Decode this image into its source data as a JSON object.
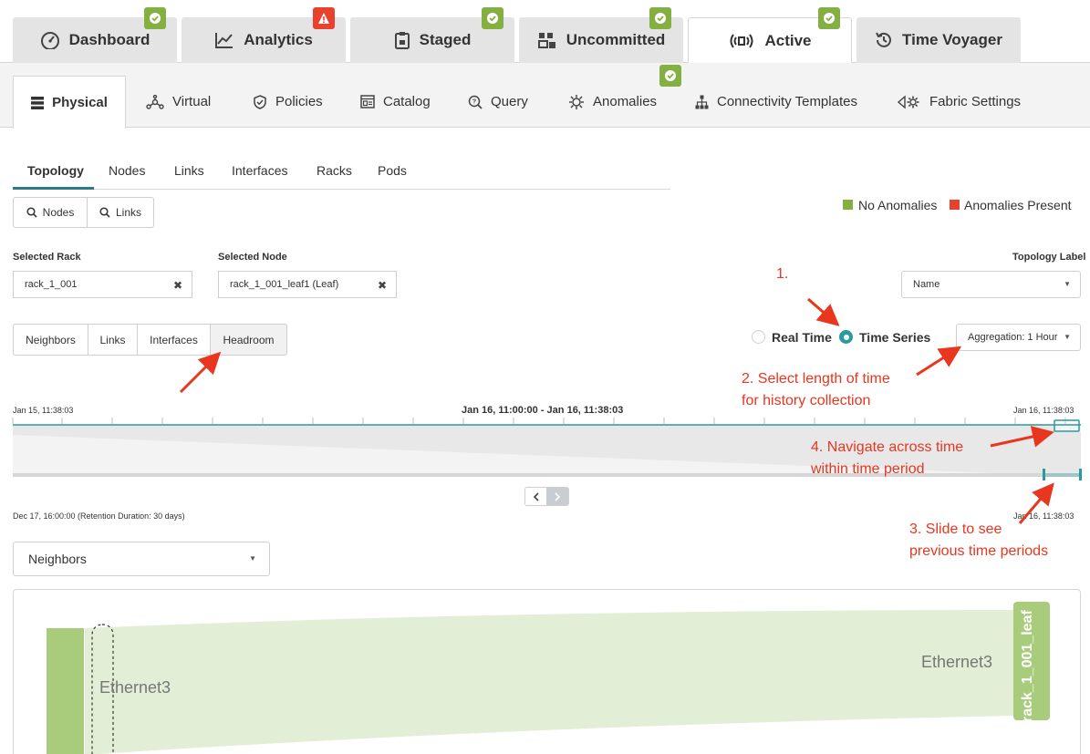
{
  "top_tabs": [
    {
      "label": "Dashboard",
      "icon": "gauge-icon",
      "status": "ok"
    },
    {
      "label": "Analytics",
      "icon": "chart-line-icon",
      "status": "warning"
    },
    {
      "label": "Staged",
      "icon": "clipboard-icon",
      "status": "ok"
    },
    {
      "label": "Uncommitted",
      "icon": "diff-icon",
      "status": "ok"
    },
    {
      "label": "Active",
      "icon": "broadcast-icon",
      "status": "ok",
      "active": true
    },
    {
      "label": "Time Voyager",
      "icon": "history-icon"
    }
  ],
  "sub_tabs": [
    {
      "label": "Physical",
      "icon": "server-icon",
      "active": true
    },
    {
      "label": "Virtual",
      "icon": "network-nodes-icon"
    },
    {
      "label": "Policies",
      "icon": "shield-icon"
    },
    {
      "label": "Catalog",
      "icon": "catalog-icon"
    },
    {
      "label": "Query",
      "icon": "search-query-icon"
    },
    {
      "label": "Anomalies",
      "icon": "anomaly-icon",
      "status": "ok"
    },
    {
      "label": "Connectivity Templates",
      "icon": "hierarchy-icon"
    },
    {
      "label": "Fabric Settings",
      "icon": "fabric-settings-icon"
    }
  ],
  "view_tabs": [
    "Topology",
    "Nodes",
    "Links",
    "Interfaces",
    "Racks",
    "Pods"
  ],
  "search": {
    "nodes": "Nodes",
    "links": "Links"
  },
  "legend": {
    "ok": "No Anomalies",
    "bad": "Anomalies Present",
    "ok_color": "#84b042",
    "bad_color": "#e8412e"
  },
  "selected_rack": {
    "label": "Selected Rack",
    "value": "rack_1_001"
  },
  "selected_node": {
    "label": "Selected Node",
    "value": "rack_1_001_leaf1 (Leaf)"
  },
  "topology_label": {
    "label": "Topology Label",
    "value": "Name"
  },
  "mode_tabs": [
    "Neighbors",
    "Links",
    "Interfaces",
    "Headroom"
  ],
  "mode_active": "Headroom",
  "radio": {
    "real_time": "Real Time",
    "time_series": "Time Series",
    "selected": "Time Series"
  },
  "aggregation": "Aggregation: 1 Hour",
  "timeline": {
    "start": "Jan 15, 11:38:03",
    "range": "Jan 16, 11:00:00 - Jan 16, 11:38:03",
    "end": "Jan 16, 11:38:03",
    "retention": "Dec 17, 16:00:00 (Retention Duration: 30 days)",
    "end2": "Jan 16, 11:38:03",
    "accent": "#2a9aa0"
  },
  "neighbors_select": "Neighbors",
  "diagram": {
    "left_port": "Ethernet3",
    "right_port": "Ethernet3",
    "right_node": "rack_1_001_leaf",
    "node_color": "#a9cc7c",
    "link_color": "#e3eed6"
  },
  "annotations": {
    "a1": "1.",
    "a2_l1": "2. Select length of time",
    "a2_l2": "for history collection",
    "a3_l1": "3. Slide to see",
    "a3_l2": "previous time periods",
    "a4_l1": "4. Navigate across time",
    "a4_l2": "within time period",
    "color": "#e8361f"
  }
}
